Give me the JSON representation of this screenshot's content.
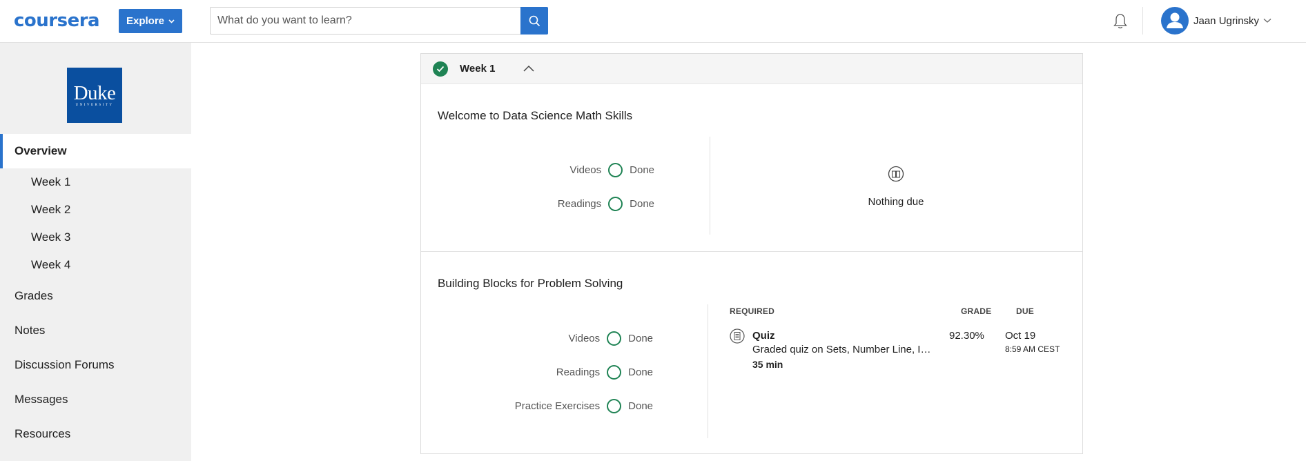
{
  "header": {
    "logo_text": "coursera",
    "explore_label": "Explore",
    "search_placeholder": "What do you want to learn?",
    "user_name": "Jaan Ugrinsky",
    "brand_color": "#2a73cc"
  },
  "sidebar": {
    "university_logo": {
      "name": "Duke",
      "subtitle": "UNIVERSITY",
      "color": "#0a4f9f"
    },
    "overview_label": "Overview",
    "weeks": [
      "Week 1",
      "Week 2",
      "Week 3",
      "Week 4"
    ],
    "items": [
      "Grades",
      "Notes",
      "Discussion Forums",
      "Messages",
      "Resources"
    ]
  },
  "week": {
    "title": "Week 1",
    "completed": true,
    "lessons": [
      {
        "title": "Welcome to Data Science Math Skills",
        "progress": [
          {
            "label": "Videos",
            "status": "Done"
          },
          {
            "label": "Readings",
            "status": "Done"
          }
        ],
        "nothing_due": "Nothing due"
      },
      {
        "title": "Building Blocks for Problem Solving",
        "progress": [
          {
            "label": "Videos",
            "status": "Done"
          },
          {
            "label": "Readings",
            "status": "Done"
          },
          {
            "label": "Practice Exercises",
            "status": "Done"
          }
        ],
        "table": {
          "headers": {
            "required": "REQUIRED",
            "grade": "GRADE",
            "due": "DUE"
          },
          "items": [
            {
              "type": "Quiz",
              "description": "Graded quiz on Sets, Number Line, Ine...",
              "duration": "35 min",
              "grade": "92.30%",
              "due_date": "Oct 19",
              "due_time": "8:59 AM CEST"
            }
          ]
        }
      }
    ]
  },
  "colors": {
    "success": "#1f8354"
  }
}
